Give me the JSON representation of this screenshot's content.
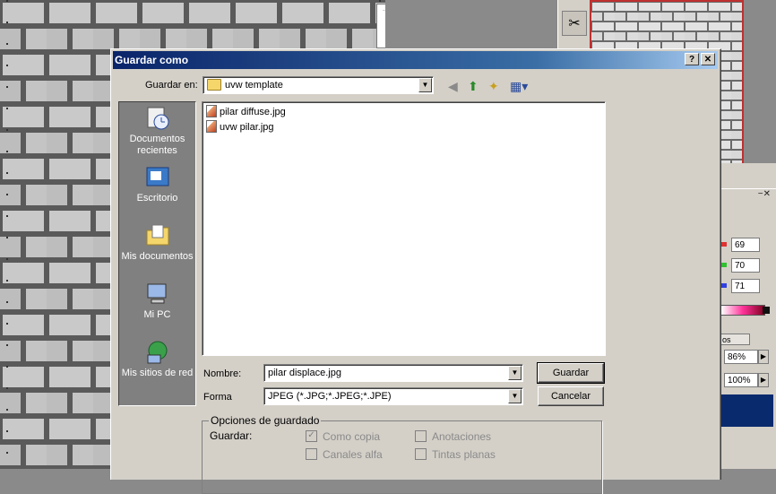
{
  "dialog": {
    "title": "Guardar como",
    "help_btn": "?",
    "close_btn": "✕",
    "save_in_label": "Guardar en:",
    "save_in_value": "uvw template",
    "places": [
      {
        "label": "Documentos recientes"
      },
      {
        "label": "Escritorio"
      },
      {
        "label": "Mis documentos"
      },
      {
        "label": "Mi PC"
      },
      {
        "label": "Mis sitios de red"
      }
    ],
    "files": [
      "pilar diffuse.jpg",
      "uvw pilar.jpg"
    ],
    "name_label": "Nombre:",
    "name_value": "pilar displace.jpg",
    "format_label": "Forma",
    "format_value": "JPEG (*.JPG;*.JPEG;*.JPE)",
    "save_button": "Guardar",
    "cancel_button": "Cancelar",
    "options_title": "Opciones de guardado",
    "save_options_label": "Guardar:",
    "options": [
      {
        "label": "Como copia",
        "checked": true
      },
      {
        "label": "Anotaciones",
        "checked": false
      },
      {
        "label": "Canales alfa",
        "checked": false
      },
      {
        "label": "Tintas planas",
        "checked": false
      }
    ]
  },
  "right_panel": {
    "rgb": [
      "69",
      "70",
      "71"
    ],
    "tab_label": "os",
    "zoom_1": "86%",
    "zoom_2": "100%"
  }
}
